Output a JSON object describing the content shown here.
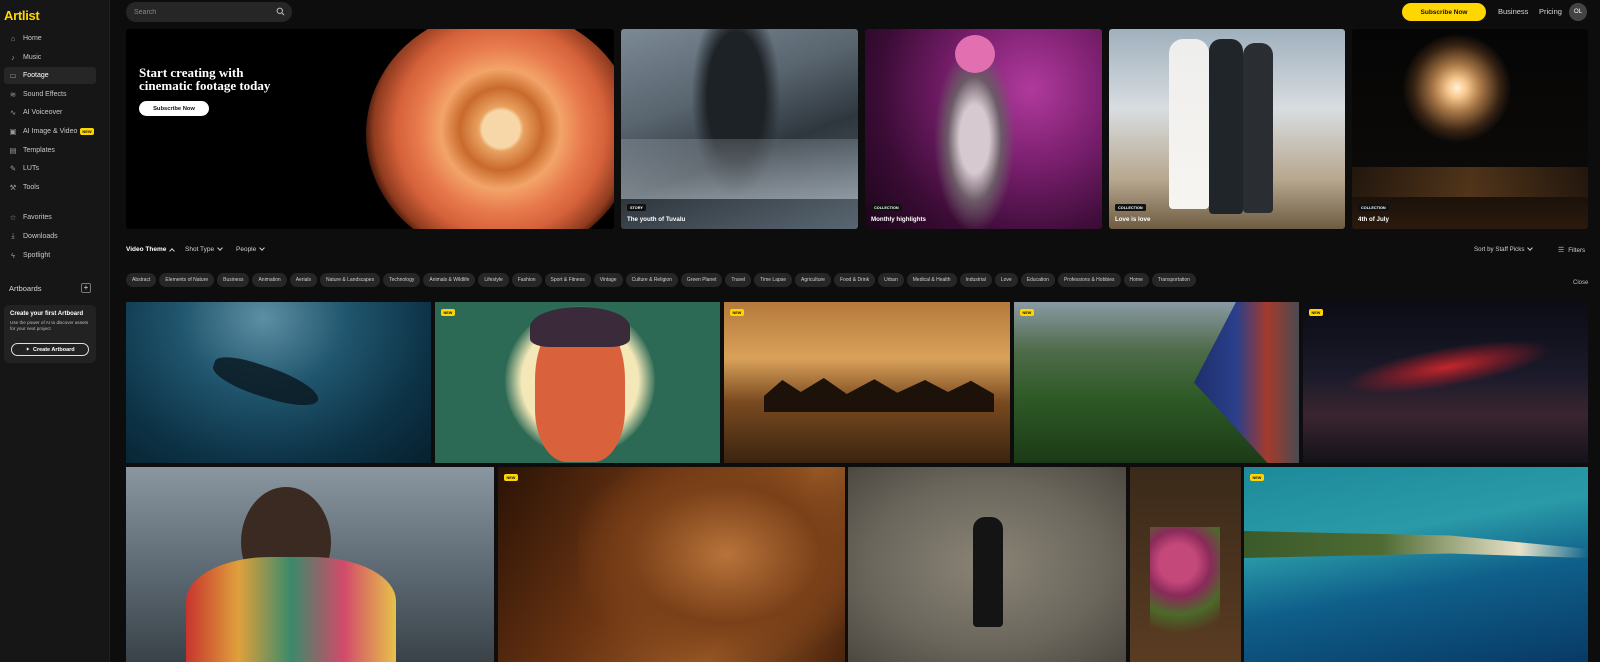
{
  "app": {
    "logo": "Artlist"
  },
  "sidebar": {
    "items": [
      {
        "label": "Home",
        "icon": "home-icon",
        "glyph": "⌂"
      },
      {
        "label": "Music",
        "icon": "music-icon",
        "glyph": "♪"
      },
      {
        "label": "Footage",
        "icon": "footage-icon",
        "glyph": "▭",
        "active": true
      },
      {
        "label": "Sound Effects",
        "icon": "sound-effects-icon",
        "glyph": "≋"
      },
      {
        "label": "AI Voiceover",
        "icon": "voiceover-icon",
        "glyph": "∿"
      },
      {
        "label": "AI Image & Video",
        "icon": "ai-image-icon",
        "glyph": "▣",
        "badge": "NEW"
      },
      {
        "label": "Templates",
        "icon": "templates-icon",
        "glyph": "▤"
      },
      {
        "label": "LUTs",
        "icon": "luts-icon",
        "glyph": "✎"
      },
      {
        "label": "Tools",
        "icon": "tools-icon",
        "glyph": "⚒"
      }
    ],
    "secondary": [
      {
        "label": "Favorites",
        "icon": "star-icon",
        "glyph": "☆"
      },
      {
        "label": "Downloads",
        "icon": "download-icon",
        "glyph": "⤓"
      },
      {
        "label": "Spotlight",
        "icon": "spotlight-icon",
        "glyph": "ϟ"
      }
    ],
    "artboards": {
      "title": "Artboards",
      "add": "+",
      "card_title": "Create your first Artboard",
      "card_desc": "Use the power of AI to discover assets for your next project",
      "button": "Create Artboard"
    }
  },
  "topbar": {
    "search_placeholder": "Search",
    "subscribe": "Subscribe Now",
    "business": "Business",
    "pricing": "Pricing",
    "avatar": "OL"
  },
  "hero": {
    "title": "Start creating with cinematic footage today",
    "cta": "Subscribe Now",
    "cards": [
      {
        "chip": "STORY",
        "caption": "The youth of Tuvalu"
      },
      {
        "chip": "COLLECTION",
        "caption": "Monthly highlights"
      },
      {
        "chip": "COLLECTION",
        "caption": "Love is love"
      },
      {
        "chip": "COLLECTION",
        "caption": "4th of July"
      }
    ]
  },
  "filters": {
    "video_theme": "Video Theme",
    "shot_type": "Shot Type",
    "people": "People",
    "sort": "Sort by Staff Picks",
    "filters": "Filters",
    "close": "Close"
  },
  "tags": [
    "Abstract",
    "Elements of Nature",
    "Business",
    "Animation",
    "Aerials",
    "Nature & Landscapes",
    "Technology",
    "Animals & Wildlife",
    "Lifestyle",
    "Fashion",
    "Sport & Fitness",
    "Vintage",
    "Culture & Religion",
    "Green Planet",
    "Travel",
    "Time Lapse",
    "Agriculture",
    "Food & Drink",
    "Urban",
    "Medical & Health",
    "Industrial",
    "Love",
    "Education",
    "Professions & Hobbies",
    "Home",
    "Transportation"
  ],
  "grid": {
    "new_label": "NEW"
  }
}
